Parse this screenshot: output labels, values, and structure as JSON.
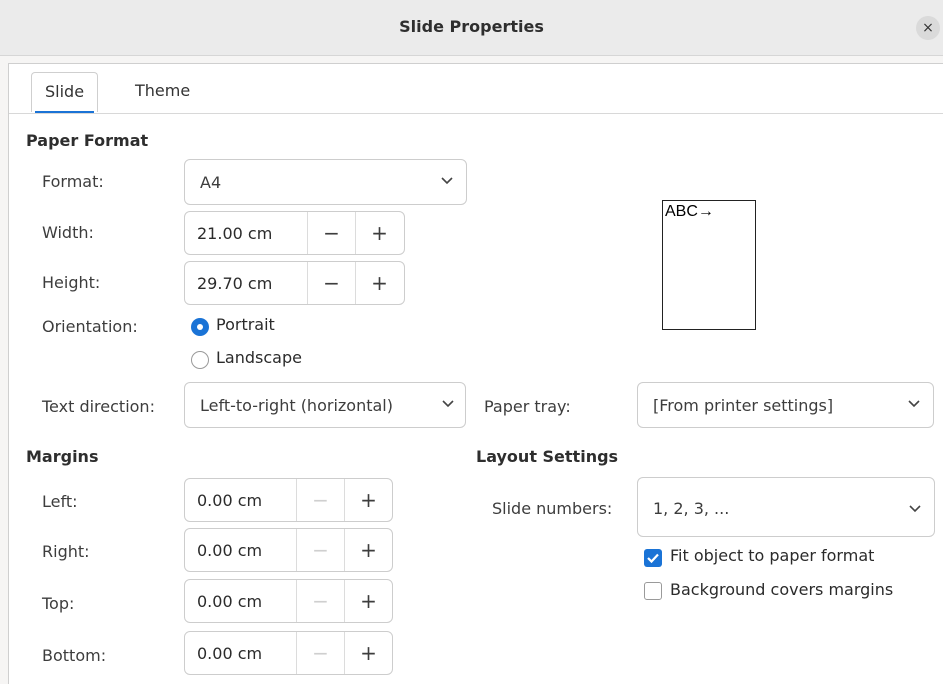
{
  "window": {
    "title": "Slide Properties",
    "close_glyph": "×"
  },
  "tabs": [
    {
      "label": "Slide",
      "active": true
    },
    {
      "label": "Theme",
      "active": false
    }
  ],
  "paper_format": {
    "heading": "Paper Format",
    "format": {
      "label": "Format:",
      "value": "A4"
    },
    "width": {
      "label": "Width:",
      "value": "21.00 cm"
    },
    "height": {
      "label": "Height:",
      "value": "29.70 cm"
    },
    "orientation": {
      "label": "Orientation:",
      "portrait": "Portrait",
      "landscape": "Landscape",
      "selected": "Portrait"
    },
    "text_direction": {
      "label": "Text direction:",
      "value": "Left-to-right (horizontal)"
    },
    "paper_tray": {
      "label": "Paper tray:",
      "value": "[From printer settings]"
    },
    "preview_text": "ABC→"
  },
  "margins": {
    "heading": "Margins",
    "left": {
      "label": "Left:",
      "value": "0.00 cm"
    },
    "right": {
      "label": "Right:",
      "value": "0.00 cm"
    },
    "top": {
      "label": "Top:",
      "value": "0.00 cm"
    },
    "bottom": {
      "label": "Bottom:",
      "value": "0.00 cm"
    }
  },
  "layout": {
    "heading": "Layout Settings",
    "slide_numbers": {
      "label": "Slide numbers:",
      "value": "1, 2, 3, ..."
    },
    "fit_object": {
      "label": "Fit object to paper format",
      "checked": true
    },
    "background_covers": {
      "label": "Background covers margins",
      "checked": false
    }
  },
  "spin_glyphs": {
    "minus": "−",
    "plus": "+"
  },
  "colors": {
    "accent": "#1a73d6",
    "window_bg": "#f6f5f4",
    "titlebar_bg": "#ebebeb"
  },
  "icons": [
    "close-icon",
    "chevron-down-icon",
    "checkmark-icon",
    "minus-icon",
    "plus-icon"
  ]
}
